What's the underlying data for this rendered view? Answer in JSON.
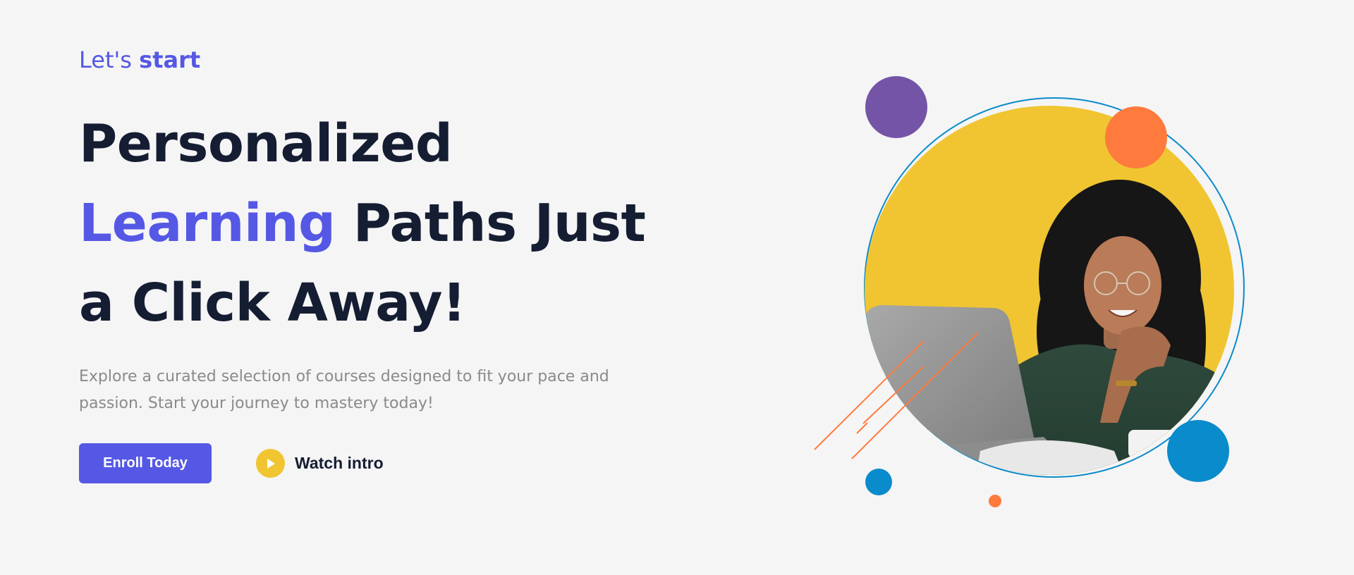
{
  "hero": {
    "eyebrow_prefix": "Let's",
    "eyebrow_bold": "start",
    "headline": {
      "line1": "Personalized",
      "line2_accent": "Learning",
      "line2_rest": "Paths Just",
      "line3": "a Click Away!"
    },
    "description": "Explore a curated selection of courses designed to fit your pace and passion. Start your journey to mastery today!",
    "enroll_label": "Enroll Today",
    "watch_label": "Watch intro",
    "watch_icon": "play-icon"
  },
  "colors": {
    "accent": "#5558e4",
    "heading": "#151d33",
    "text_muted": "#8a8a8a",
    "background": "#f5f5f5",
    "yellow": "#f0c531",
    "purple": "#7454a6",
    "orange": "#ff7a3d",
    "blue": "#0a8bcb"
  },
  "illustration": {
    "subject": "student-smiling-at-laptop-photo"
  }
}
